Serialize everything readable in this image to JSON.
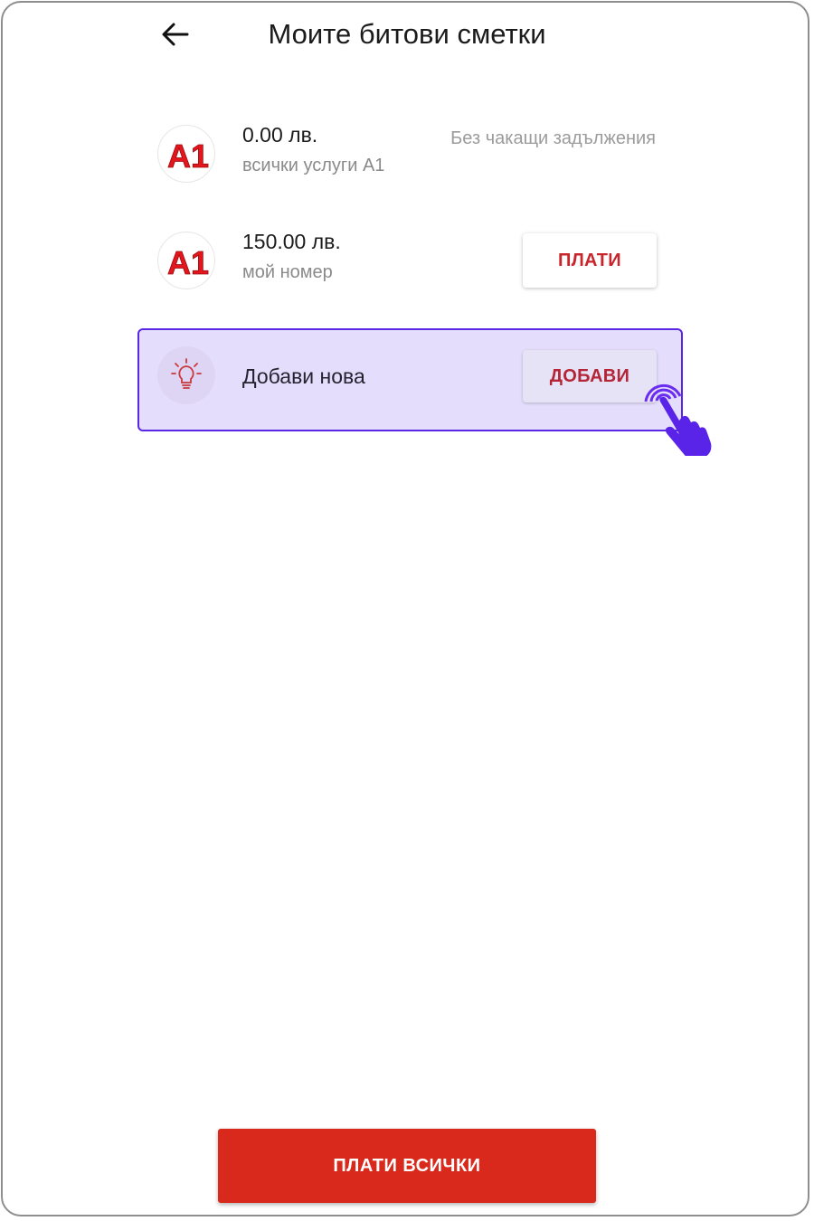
{
  "header": {
    "title": "Моите битови сметки",
    "back_icon": "arrow-left-icon"
  },
  "bills": [
    {
      "logo_text": "A1",
      "amount": "0.00 лв.",
      "label": "всички услуги A1",
      "status": "Без чакащи задължения"
    },
    {
      "logo_text": "A1",
      "amount": "150.00 лв.",
      "label": "мой номер",
      "button": "ПЛАТИ"
    }
  ],
  "add_new": {
    "label": "Добави нова",
    "button": "ДОБАВИ",
    "icon": "lightbulb-icon"
  },
  "footer": {
    "pay_all": "ПЛАТИ ВСИЧКИ"
  },
  "colors": {
    "brand_red": "#d9291c",
    "highlight_bg": "#e4defc",
    "highlight_border": "#5b27e6"
  }
}
